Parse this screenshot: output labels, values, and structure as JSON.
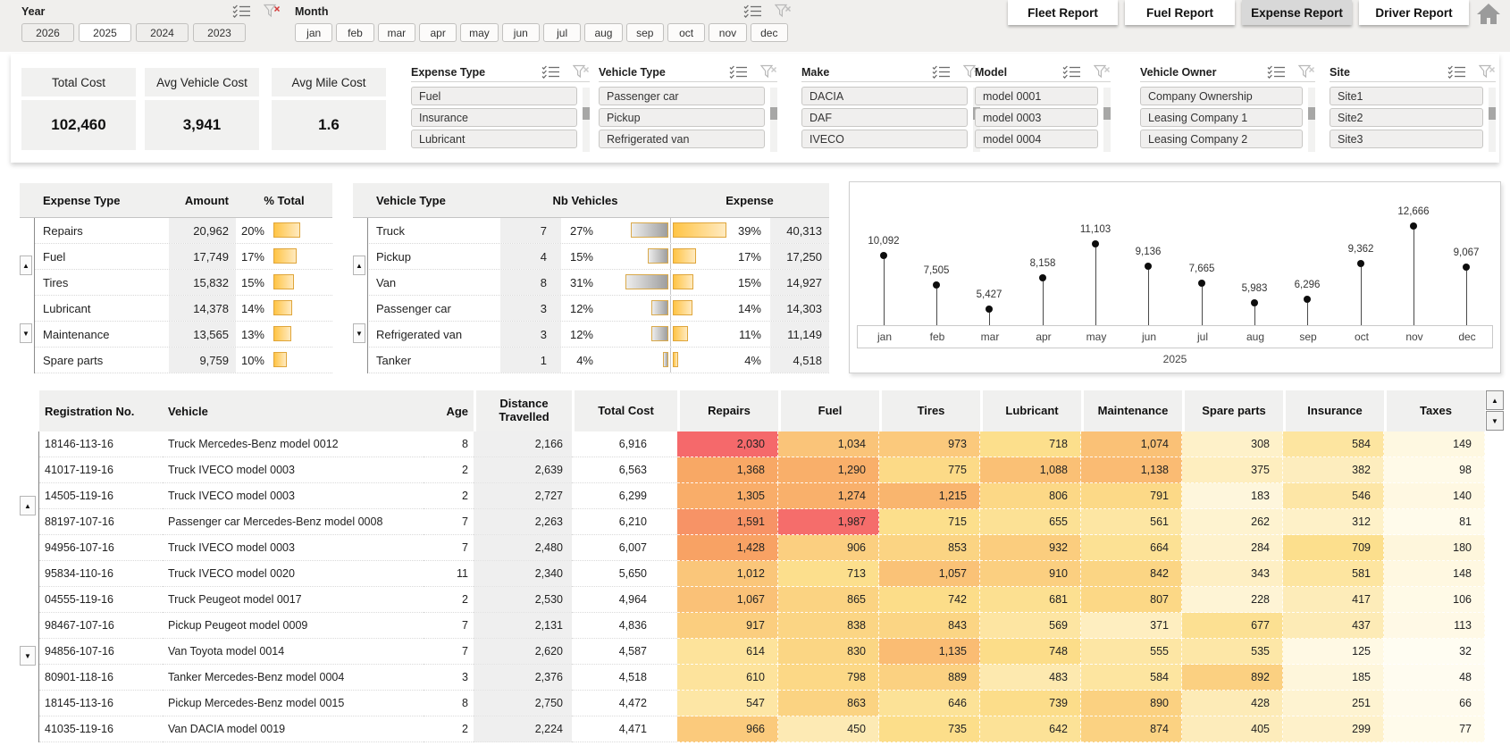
{
  "topbar": {
    "year": {
      "label": "Year",
      "options": [
        "2026",
        "2025",
        "2024",
        "2023"
      ],
      "selected": "2025"
    },
    "month": {
      "label": "Month",
      "options": [
        "jan",
        "feb",
        "mar",
        "apr",
        "may",
        "jun",
        "jul",
        "aug",
        "sep",
        "oct",
        "nov",
        "dec"
      ]
    },
    "tabs": [
      {
        "label": "Fleet Report",
        "active": false
      },
      {
        "label": "Fuel Report",
        "active": false
      },
      {
        "label": "Expense Report",
        "active": true
      },
      {
        "label": "Driver Report",
        "active": false
      }
    ]
  },
  "kpis": [
    {
      "label": "Total Cost",
      "value": "102,460"
    },
    {
      "label": "Avg Vehicle Cost",
      "value": "3,941"
    },
    {
      "label": "Avg Mile Cost",
      "value": "1.6"
    }
  ],
  "slicers": [
    {
      "title": "Expense Type",
      "items": [
        "Fuel",
        "Insurance",
        "Lubricant"
      ]
    },
    {
      "title": "Vehicle Type",
      "items": [
        "Passenger car",
        "Pickup",
        "Refrigerated van"
      ]
    },
    {
      "title": "Make",
      "items": [
        "DACIA",
        "DAF",
        "IVECO"
      ]
    },
    {
      "title": "Model",
      "items": [
        "model 0001",
        "model 0003",
        "model 0004"
      ]
    },
    {
      "title": "Vehicle Owner",
      "items": [
        "Company Ownership",
        "Leasing Company 1",
        "Leasing Company 2"
      ]
    },
    {
      "title": "Site",
      "items": [
        "Site1",
        "Site2",
        "Site3"
      ]
    }
  ],
  "expense_table": {
    "headers": [
      "Expense Type",
      "Amount",
      "% Total"
    ],
    "rows": [
      {
        "type": "Repairs",
        "amount": "20,962",
        "pct": 20
      },
      {
        "type": "Fuel",
        "amount": "17,749",
        "pct": 17
      },
      {
        "type": "Tires",
        "amount": "15,832",
        "pct": 15
      },
      {
        "type": "Lubricant",
        "amount": "14,378",
        "pct": 14
      },
      {
        "type": "Maintenance",
        "amount": "13,565",
        "pct": 13
      },
      {
        "type": "Spare parts",
        "amount": "9,759",
        "pct": 10
      }
    ]
  },
  "vehicle_table": {
    "headers": [
      "Vehicle Type",
      "Nb Vehicles",
      "Expense"
    ],
    "rows": [
      {
        "type": "Truck",
        "nb": "7",
        "nb_pct": 27,
        "exp_pct": 39,
        "expense": "40,313"
      },
      {
        "type": "Pickup",
        "nb": "4",
        "nb_pct": 15,
        "exp_pct": 17,
        "expense": "17,250"
      },
      {
        "type": "Van",
        "nb": "8",
        "nb_pct": 31,
        "exp_pct": 15,
        "expense": "14,927"
      },
      {
        "type": "Passenger car",
        "nb": "3",
        "nb_pct": 12,
        "exp_pct": 14,
        "expense": "14,303"
      },
      {
        "type": "Refrigerated van",
        "nb": "3",
        "nb_pct": 12,
        "exp_pct": 11,
        "expense": "11,149"
      },
      {
        "type": "Tanker",
        "nb": "1",
        "nb_pct": 4,
        "exp_pct": 4,
        "expense": "4,518"
      }
    ]
  },
  "chart_data": {
    "type": "scatter",
    "style": "lollipop",
    "x": [
      "jan",
      "feb",
      "mar",
      "apr",
      "may",
      "jun",
      "jul",
      "aug",
      "sep",
      "oct",
      "nov",
      "dec"
    ],
    "values": [
      10092,
      7505,
      5427,
      8158,
      11103,
      9136,
      7665,
      5983,
      6296,
      9362,
      12666,
      9067
    ],
    "year_label": "2025",
    "ylim": [
      0,
      13500
    ],
    "grid": false,
    "legend": false
  },
  "main_table": {
    "headers": [
      "Registration No.",
      "Vehicle",
      "Age",
      "Distance Travelled",
      "Total Cost",
      "Repairs",
      "Fuel",
      "Tires",
      "Lubricant",
      "Maintenance",
      "Spare parts",
      "Insurance",
      "Taxes"
    ],
    "rows": [
      [
        "18146-113-16",
        "Truck Mercedes-Benz model 0012",
        "8",
        "2,166",
        "6,916",
        "2,030",
        "1,034",
        "973",
        "718",
        "1,074",
        "308",
        "584",
        "149"
      ],
      [
        "41017-119-16",
        "Truck IVECO model 0003",
        "2",
        "2,639",
        "6,563",
        "1,368",
        "1,290",
        "775",
        "1,088",
        "1,138",
        "375",
        "382",
        "98"
      ],
      [
        "14505-119-16",
        "Truck IVECO model 0003",
        "2",
        "2,727",
        "6,299",
        "1,305",
        "1,274",
        "1,215",
        "806",
        "791",
        "183",
        "546",
        "140"
      ],
      [
        "88197-107-16",
        "Passenger car Mercedes-Benz model 0008",
        "7",
        "2,263",
        "6,210",
        "1,591",
        "1,987",
        "715",
        "655",
        "561",
        "262",
        "312",
        "81"
      ],
      [
        "94956-107-16",
        "Truck IVECO model 0003",
        "7",
        "2,480",
        "6,007",
        "1,428",
        "906",
        "853",
        "932",
        "664",
        "284",
        "709",
        "180"
      ],
      [
        "95834-110-16",
        "Truck IVECO model 0020",
        "11",
        "2,340",
        "5,650",
        "1,012",
        "713",
        "1,057",
        "910",
        "842",
        "343",
        "581",
        "148"
      ],
      [
        "04555-119-16",
        "Truck Peugeot model 0017",
        "2",
        "2,530",
        "4,964",
        "1,067",
        "865",
        "742",
        "681",
        "807",
        "228",
        "417",
        "106"
      ],
      [
        "98467-107-16",
        "Pickup Peugeot model 0009",
        "7",
        "2,131",
        "4,836",
        "917",
        "838",
        "843",
        "569",
        "371",
        "677",
        "437",
        "113"
      ],
      [
        "94856-107-16",
        "Van Toyota model 0014",
        "7",
        "2,620",
        "4,587",
        "614",
        "830",
        "1,135",
        "748",
        "555",
        "535",
        "125",
        "32"
      ],
      [
        "80901-118-16",
        "Tanker Mercedes-Benz model 0004",
        "3",
        "2,376",
        "4,518",
        "610",
        "798",
        "889",
        "483",
        "584",
        "892",
        "185",
        "48"
      ],
      [
        "18145-113-16",
        "Pickup Mercedes-Benz model 0015",
        "8",
        "2,750",
        "4,472",
        "547",
        "863",
        "646",
        "739",
        "890",
        "428",
        "251",
        "66"
      ],
      [
        "41035-119-16",
        "Van DACIA model 0019",
        "2",
        "2,224",
        "4,471",
        "966",
        "450",
        "735",
        "642",
        "874",
        "405",
        "299",
        "77"
      ]
    ]
  },
  "colors": {
    "bar_orange": "#FFC445",
    "bar_gray": "#9E9E9E",
    "heat_low": "#FFFDF2",
    "heat_mid": "#FCDE8A",
    "heat_high": "#F5696B",
    "tab_active": "#D8D8D8",
    "clear_filter_active": "#D23A3A"
  }
}
